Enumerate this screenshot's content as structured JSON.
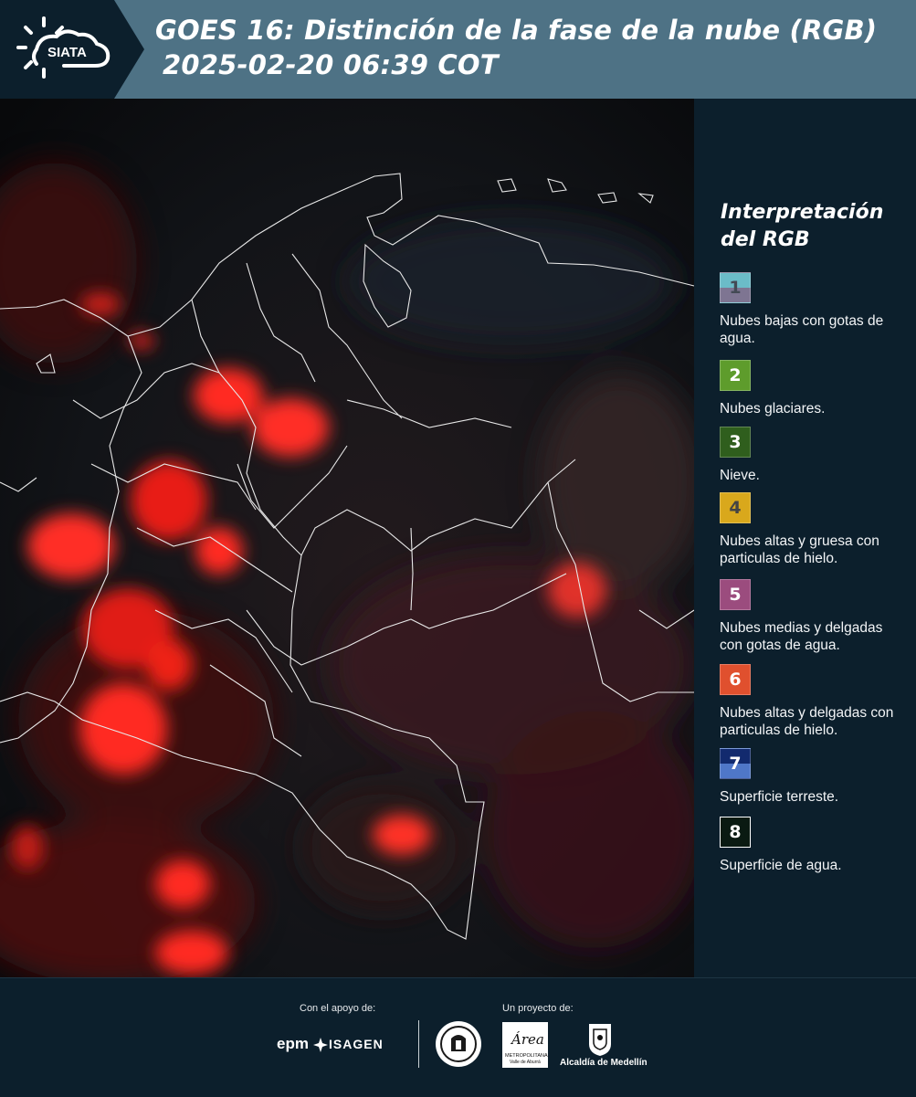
{
  "header": {
    "logo_text": "SIATA",
    "title_line1": "GOES 16: Distinción de la fase de la nube (RGB)",
    "title_line2": "2025-02-20 06:39 COT",
    "background_color": "#4e7285",
    "logo_background_color": "#0c1f2c"
  },
  "legend": {
    "title_line1": "Interpretación",
    "title_line2": "del RGB",
    "items": [
      {
        "number": "1",
        "label": "Nubes bajas con gotas de agua.",
        "color_top": "#6bbcc8",
        "color_bottom": "#7e7592",
        "number_color": "#444a55"
      },
      {
        "number": "2",
        "label": "Nubes glaciares.",
        "color_top": "#5e9c2c",
        "color_bottom": "#5e9c2c",
        "number_color": "#ffffff"
      },
      {
        "number": "3",
        "label": "Nieve.",
        "color_top": "#2f5e1d",
        "color_bottom": "#2f5e1d",
        "number_color": "#ffffff"
      },
      {
        "number": "4",
        "label": "Nubes altas y gruesa con particulas de hielo.",
        "color_top": "#d9a81c",
        "color_bottom": "#d9a81c",
        "number_color": "#444444"
      },
      {
        "number": "5",
        "label": "Nubes medias y delgadas con gotas de agua.",
        "color_top": "#9b4c7e",
        "color_bottom": "#9b4c7e",
        "number_color": "#ffffff"
      },
      {
        "number": "6",
        "label": "Nubes altas y delgadas con particulas de hielo.",
        "color_top": "#e0502e",
        "color_bottom": "#e0502e",
        "number_color": "#ffffff"
      },
      {
        "number": "7",
        "label": "Superficie terreste.",
        "color_top": "#122a6e",
        "color_bottom": "#4f77c8",
        "number_color": "#ffffff"
      },
      {
        "number": "8",
        "label": "Superficie de agua.",
        "color_top": "#0a1a12",
        "color_bottom": "#0a1a12",
        "number_color": "#ffffff"
      }
    ]
  },
  "footer": {
    "support_label": "Con el apoyo de:",
    "project_label": "Un proyecto de:",
    "sponsor_epm": "epm",
    "sponsor_isagen": "ISAGEN",
    "partner_metropolitana_line1": "Área",
    "partner_metropolitana_line2": "METROPOLITANA",
    "partner_metropolitana_line3": "Valle de Aburrá",
    "partner_alcaldia": "Alcaldía de Medellín"
  }
}
